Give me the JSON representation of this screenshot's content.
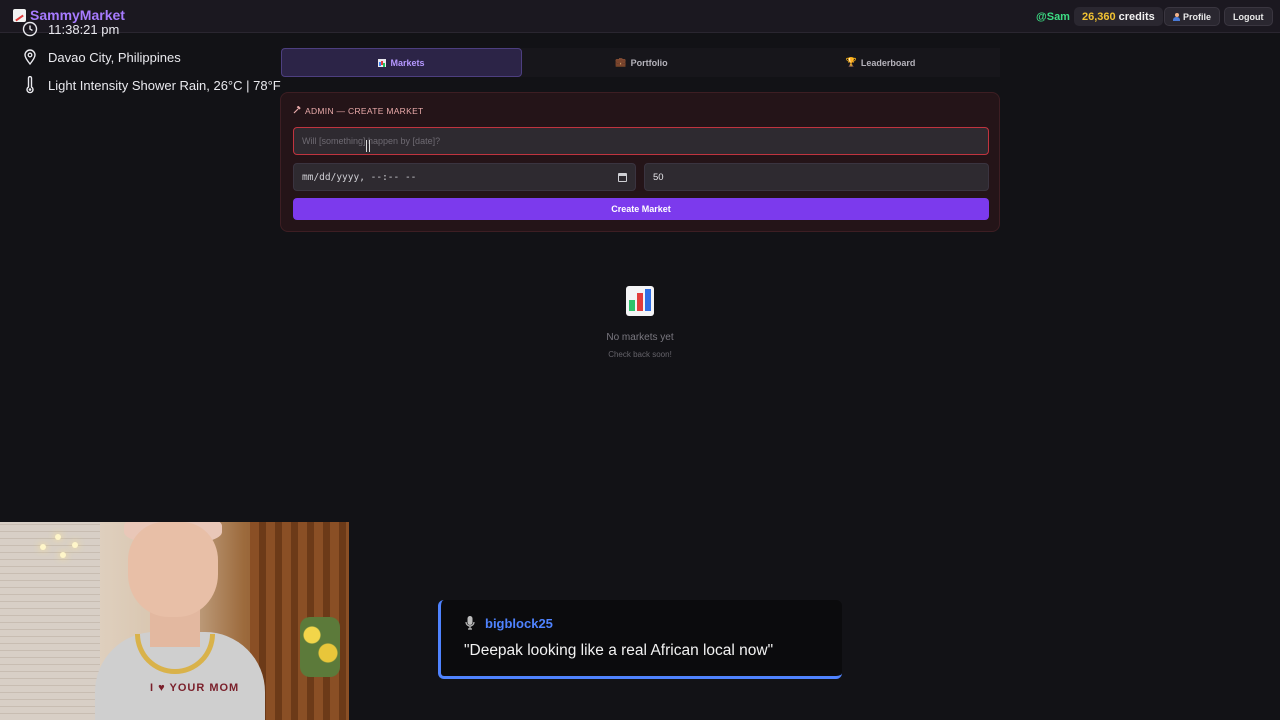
{
  "topbar": {
    "brand": "SammyMarket",
    "handle": "@Sam",
    "credits_amount": "26,360",
    "credits_label": "credits",
    "profile_label": "Profile",
    "logout_label": "Logout"
  },
  "overlay": {
    "time": "11:38:21 pm",
    "location": "Davao City, Philippines",
    "weather": "Light Intensity Shower Rain, 26°C | 78°F"
  },
  "tabs": [
    {
      "label": "Markets",
      "icon": "chart-icon",
      "active": true
    },
    {
      "label": "Portfolio",
      "icon": "briefcase-icon",
      "active": false
    },
    {
      "label": "Leaderboard",
      "icon": "trophy-icon",
      "active": false
    }
  ],
  "admin": {
    "title": "ADMIN — CREATE MARKET",
    "question_placeholder": "Will [something] happen by [date]?",
    "date_placeholder": "mm/dd/yyyy, --:-- --",
    "amount_value": "50",
    "create_label": "Create Market"
  },
  "empty_state": {
    "title": "No markets yet",
    "subtitle": "Check back soon!"
  },
  "chat": {
    "username": "bigblock25",
    "message": "\"Deepak looking like a real African local now\""
  },
  "webcam": {
    "shirt_text": "I ♥ YOUR MOM"
  },
  "colors": {
    "accent": "#7c3aed",
    "brand": "#a77bff",
    "credits": "#f1c232",
    "handle": "#3ddc84",
    "chat_accent": "#4f83ff"
  }
}
